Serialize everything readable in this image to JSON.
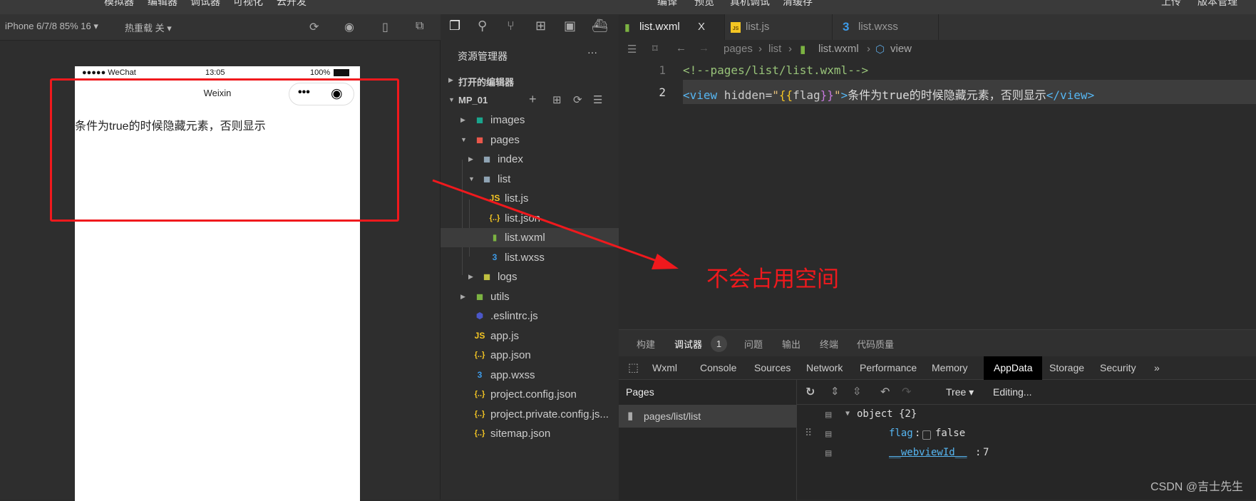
{
  "menubar": {
    "left": [
      "模拟器",
      "编辑器",
      "调试器",
      "可视化",
      "云开发"
    ],
    "middle": [
      "编译",
      "预览",
      "真机调试",
      "清缓存"
    ],
    "right": [
      "上传",
      "版本管理"
    ]
  },
  "simulator": {
    "device": "iPhone 6/7/8 85% 16 ▾",
    "hotreload": "热重载 关 ▾",
    "phone": {
      "carrier": "●●●●● WeChat",
      "time": "13:05",
      "battery": "100%",
      "nav_title": "Weixin",
      "content": "条件为true的时候隐藏元素，否则显示"
    }
  },
  "explorer": {
    "title": "资源管理器",
    "more": "···",
    "open_editors": "打开的编辑器",
    "project": "MP_01",
    "items": [
      {
        "label": "images",
        "level": 0,
        "type": "folder",
        "expanded": false,
        "color": "#1aa58d"
      },
      {
        "label": "pages",
        "level": 0,
        "type": "folder",
        "expanded": true,
        "color": "#e9574b"
      },
      {
        "label": "index",
        "level": 1,
        "type": "folder",
        "expanded": false,
        "color": "#8fa3b3"
      },
      {
        "label": "list",
        "level": 1,
        "type": "folder",
        "expanded": true,
        "color": "#8fa3b3"
      },
      {
        "label": "list.js",
        "level": 2,
        "type": "js",
        "color": "#f5c623"
      },
      {
        "label": "list.json",
        "level": 2,
        "type": "json",
        "color": "#f5c623"
      },
      {
        "label": "list.wxml",
        "level": 2,
        "type": "wxml",
        "color": "#7cb342",
        "selected": true
      },
      {
        "label": "list.wxss",
        "level": 2,
        "type": "wxss",
        "color": "#3d9be9"
      },
      {
        "label": "logs",
        "level": 1,
        "type": "folder",
        "expanded": false,
        "color": "#c0c040"
      },
      {
        "label": "utils",
        "level": 0,
        "type": "folder",
        "expanded": false,
        "color": "#7cb342"
      },
      {
        "label": ".eslintrc.js",
        "level": 0,
        "type": "eslint",
        "color": "#4b57c8"
      },
      {
        "label": "app.js",
        "level": 0,
        "type": "js",
        "color": "#f5c623"
      },
      {
        "label": "app.json",
        "level": 0,
        "type": "json",
        "color": "#f5c623"
      },
      {
        "label": "app.wxss",
        "level": 0,
        "type": "wxss",
        "color": "#3d9be9"
      },
      {
        "label": "project.config.json",
        "level": 0,
        "type": "json",
        "color": "#f5c623"
      },
      {
        "label": "project.private.config.js...",
        "level": 0,
        "type": "json",
        "color": "#f5c623"
      },
      {
        "label": "sitemap.json",
        "level": 0,
        "type": "json",
        "color": "#f5c623"
      }
    ]
  },
  "editor": {
    "tabs": [
      {
        "label": "list.wxml",
        "active": true,
        "close": "X"
      },
      {
        "label": "list.js"
      },
      {
        "label": "list.wxss"
      }
    ],
    "breadcrumb": [
      "pages",
      "list",
      "list.wxml",
      "view"
    ],
    "lines": [
      {
        "n": "1",
        "text": "<!--pages/list/list.wxml-->"
      },
      {
        "n": "2",
        "p1": "<view",
        "p2": " hidden=",
        "p3": "\"",
        "p4": "{{",
        "p5": "flag",
        "p6": "}}",
        "p7": "\"",
        "p8": ">",
        "p9": "条件为true的时候隐藏元素，否则显示",
        "p10": "</view>"
      }
    ]
  },
  "devtools": {
    "tabs": [
      "构建",
      "调试器",
      "问题",
      "输出",
      "终端",
      "代码质量"
    ],
    "badge": "1",
    "chrome_tabs": [
      "Wxml",
      "Console",
      "Sources",
      "Network",
      "Performance",
      "Memory",
      "AppData",
      "Storage",
      "Security",
      "»"
    ],
    "active_tab": "AppData",
    "pages_title": "Pages",
    "page": "pages/list/list",
    "view_mode": "Tree ▾",
    "editing": "Editing...",
    "tree": {
      "root": "object {2}",
      "flag_key": "flag",
      "flag_value": "false",
      "wv_key": "__webviewId__",
      "wv_value": "7"
    }
  },
  "annotation": "不会占用空间",
  "watermark": "CSDN @吉士先生",
  "colors": {
    "annotation": "#f0191d",
    "tag": "#56b6f2",
    "comment": "#98c379",
    "brace": "#f5c623"
  }
}
